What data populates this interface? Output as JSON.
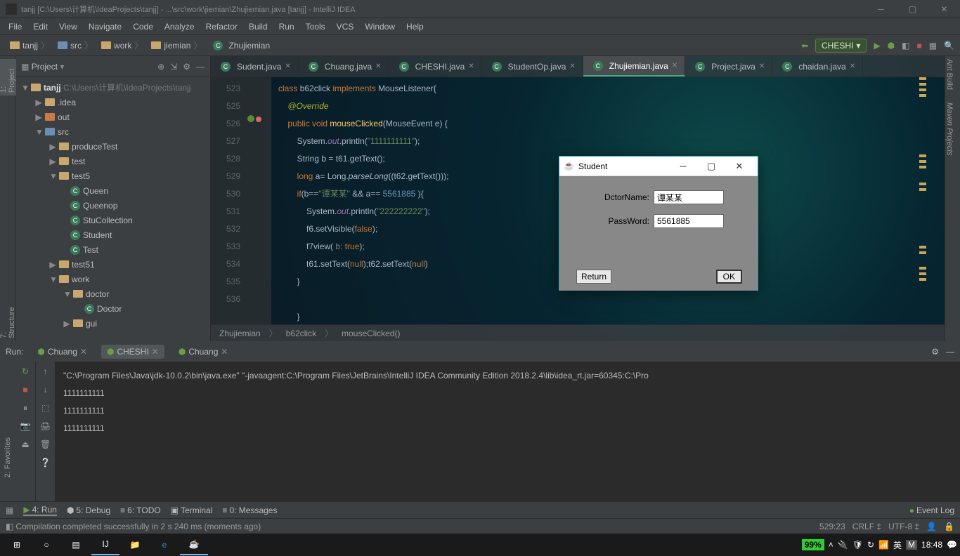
{
  "window": {
    "title": "tanjj [C:\\Users\\计算机\\IdeaProjects\\tanjj] - ...\\src\\work\\jiemian\\Zhujiemian.java [tanjj] - IntelliJ IDEA"
  },
  "menu": {
    "file": "File",
    "edit": "Edit",
    "view": "View",
    "navigate": "Navigate",
    "code": "Code",
    "analyze": "Analyze",
    "refactor": "Refactor",
    "build": "Build",
    "run": "Run",
    "tools": "Tools",
    "vcs": "VCS",
    "window": "Window",
    "help": "Help"
  },
  "navbar": {
    "crumbs": [
      "tanjj",
      "src",
      "work",
      "jiemian",
      "Zhujiemian"
    ],
    "run_config": "CHESHI"
  },
  "project_panel": {
    "title": "Project"
  },
  "tree": {
    "root": "tanjj",
    "root_path": "C:\\Users\\计算机\\IdeaProjects\\tanjj",
    "idea": ".idea",
    "out": "out",
    "src": "src",
    "produceTest": "produceTest",
    "test": "test",
    "test5": "test5",
    "queen": "Queen",
    "queenop": "Queenop",
    "stucollection": "StuCollection",
    "student": "Student",
    "test_cls": "Test",
    "test51": "test51",
    "work": "work",
    "doctor": "doctor",
    "doctor_cls": "Doctor",
    "gui": "gui"
  },
  "tabs": [
    {
      "label": "Sudent.java"
    },
    {
      "label": "Chuang.java"
    },
    {
      "label": "CHESHI.java"
    },
    {
      "label": "StudentOp.java"
    },
    {
      "label": "Zhujiemian.java",
      "active": true
    },
    {
      "label": "Project.java"
    },
    {
      "label": "chaidan.java"
    }
  ],
  "gutter": {
    "lines": [
      "523",
      "",
      "525",
      "526",
      "527",
      "528",
      "529",
      "530",
      "531",
      "532",
      "533",
      "534",
      "535",
      "536"
    ]
  },
  "code": {
    "l1a": "class ",
    "l1b": "b62click ",
    "l1c": "implements ",
    "l1d": "MouseListener{",
    "l2": "@Override",
    "l3a": "public void ",
    "l3b": "mouseClicked",
    "l3c": "(MouseEvent e) {",
    "l4a": "System.",
    "l4b": "out",
    "l4c": ".println(",
    "l4d": "\"1111111111\"",
    "l4e": ");",
    "l5a": "String b = t61.getText();",
    "l6a": "long ",
    "l6b": "a= Long.",
    "l6c": "parseLong",
    "l6d": "((t62.getText()));",
    "l7a": "if",
    "l7b": "(b==",
    "l7c": "\"谭某某\"",
    "l7d": " && a== ",
    "l7e": "5561885",
    "l7f": " ){",
    "l8a": "System.",
    "l8b": "out",
    "l8c": ".println(",
    "l8d": "\"222222222\"",
    "l8e": ");",
    "l9a": "f6.setVisible(",
    "l9b": "false",
    "l9c": ");",
    "l10a": "f7view( ",
    "l10b": "b: ",
    "l10c": "true",
    "l10d": ");",
    "l11a": "t61.setText(",
    "l11b": "null",
    "l11c": ");t62.setText(",
    "l11d": "null",
    "l11e": ")",
    "l12": "}",
    "l14": "}"
  },
  "breadcrumb": {
    "a": "Zhujiemian",
    "b": "b62click",
    "c": "mouseClicked()"
  },
  "run": {
    "title": "Run:",
    "tab1": "Chuang",
    "tab2": "CHESHI",
    "tab3": "Chuang",
    "line1": "\"C:\\Program Files\\Java\\jdk-10.0.2\\bin\\java.exe\" \"-javaagent:C:\\Program Files\\JetBrains\\IntelliJ IDEA Community Edition 2018.2.4\\lib\\idea_rt.jar=60345:C:\\Pro",
    "line2": "1111111111",
    "line3": "1111111111",
    "line4": "1111111111"
  },
  "bottom": {
    "run": "4: Run",
    "debug": "5: Debug",
    "todo": "6: TODO",
    "terminal": "Terminal",
    "messages": "0: Messages",
    "eventlog": "Event Log"
  },
  "status": {
    "msg": "Compilation completed successfully in 2 s 240 ms (moments ago)",
    "pos": "529:23",
    "sep": "CRLF",
    "enc": "UTF-8"
  },
  "right_tabs": {
    "ant": "Ant Build",
    "maven": "Maven Projects"
  },
  "left_tabs": {
    "project": "1: Project",
    "structure": "7: Structure",
    "favorites": "2: Favorites"
  },
  "dialog": {
    "title": "Student",
    "name_label": "DctorName:",
    "name_val": "谭某某",
    "pass_label": "PassWord:",
    "pass_val": "5561885",
    "return": "Return",
    "ok": "OK"
  },
  "taskbar": {
    "battery": "99%",
    "ime": "英",
    "m": "M",
    "time": "18:48"
  }
}
